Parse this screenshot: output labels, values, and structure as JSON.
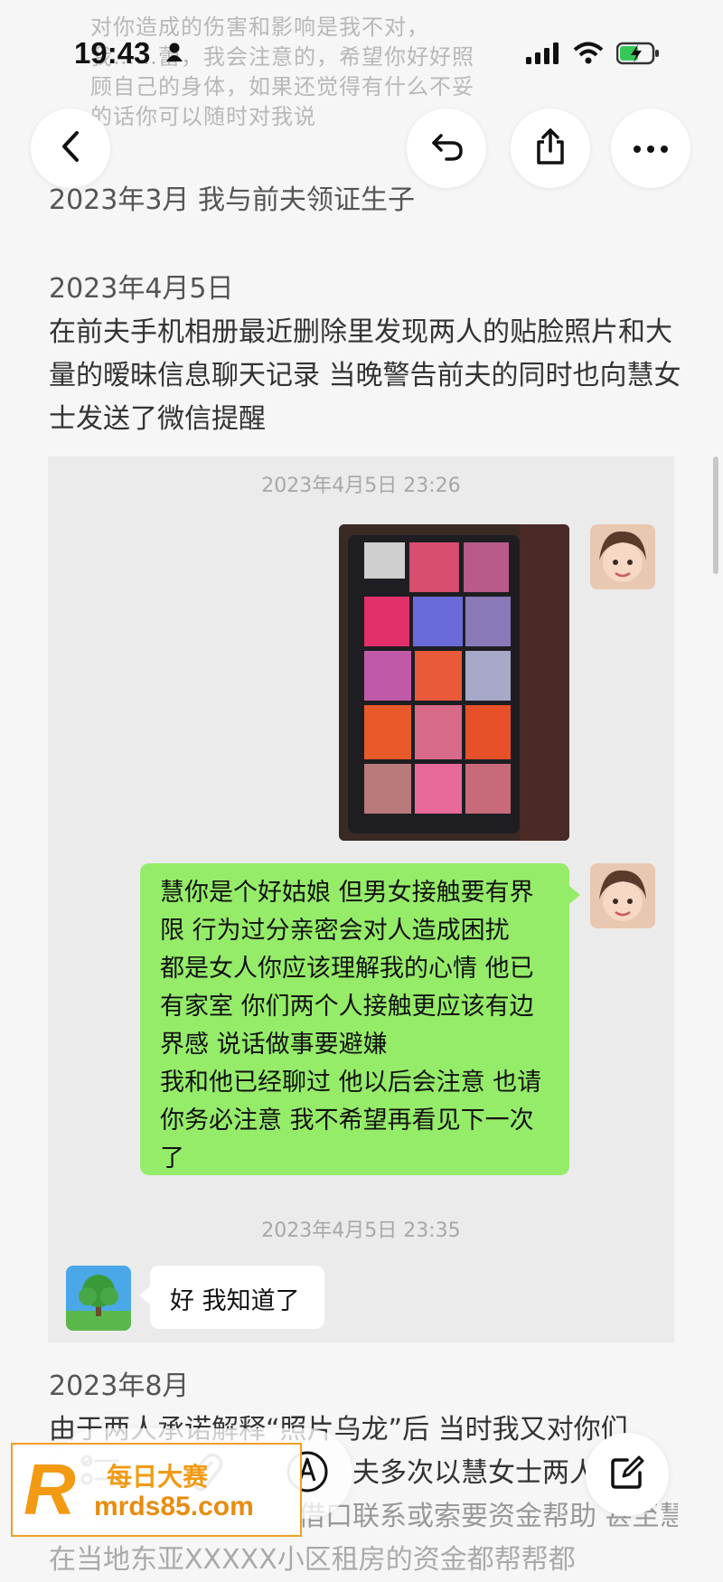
{
  "status_bar": {
    "time": "19:43"
  },
  "faded_previous_text": "对你造成的伤害和影响是我不对，我……蕾，我会注意的，希望你好好照顾自己的身体，如果还觉得有什么不妥的话你可以随时对我说",
  "note": {
    "entry1": "2023年3月 我与前夫领证生子",
    "entry2_date": "2023年4月5日",
    "entry2_body": "在前夫手机相册最近删除里发现两人的贴脸照片和大量的暧昧信息聊天记录 当晚警告前夫的同时也向慧女士发送了微信提醒",
    "entry3_date": "2023年8月",
    "entry3_line1": "由于两人承诺解释“照片乌龙”后 当时我又对你们",
    "entry3_line2": "夫多次以慧女士两人",
    "entry3_line3": "借口联系或索要资金帮助 甚至慧女士母亲",
    "entry3_line4": "在当地东亚XXXXX小区租房的资金都帮帮都"
  },
  "chat": {
    "time1": "2023年4月5日 23:26",
    "green_message": "慧你是个好姑娘 但男女接触要有界\n限 行为过分亲密会对人造成困扰\n都是女人你应该理解我的心情 他已\n有家室 你们两个人接触更应该有边\n界感 说话做事要避嫌\n我和他已经聊过 他以后会注意 也请\n你务必注意 我不希望再看见下一次\n了",
    "time2": "2023年4月5日 23:35",
    "reply": "好 我知道了"
  },
  "watermark": {
    "letter": "R",
    "name": "每日大赛",
    "url": "mrds85.com"
  },
  "colors": {
    "green_bubble": "#95ec69",
    "chat_bg": "#ebebeb",
    "watermark": "#f29a12"
  },
  "icons": [
    "back-icon",
    "undo-icon",
    "share-icon",
    "more-icon",
    "checklist-icon",
    "attachment-icon",
    "markup-icon",
    "compose-icon"
  ]
}
